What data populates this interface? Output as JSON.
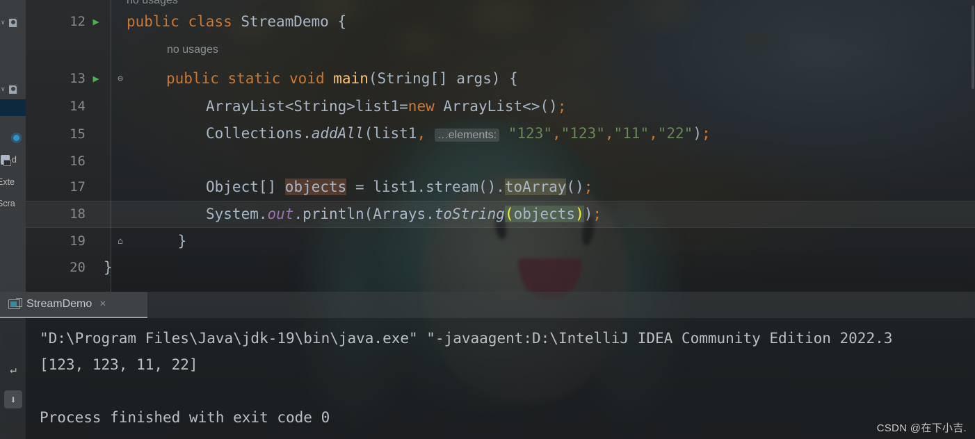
{
  "app": {
    "title": "IntelliJ IDEA Community Edition 2022.3",
    "theme_accent": "#cc7832"
  },
  "project_panel": {
    "rows": [
      {
        "chevron": "∨",
        "icon": "java-file-icon",
        "label": "",
        "selected": false
      },
      {
        "chevron": "∨",
        "icon": "java-file-icon",
        "label": "",
        "selected": false
      },
      {
        "chevron": "",
        "icon": "selected-row",
        "label": "",
        "selected": true
      },
      {
        "chevron": "",
        "icon": "circle-icon",
        "label": "",
        "selected": false
      },
      {
        "chevron": "",
        "icon": "module-icon",
        "label": "d",
        "selected": false
      },
      {
        "chevron": "",
        "icon": "",
        "label": "Exte",
        "selected": false
      },
      {
        "chevron": "",
        "icon": "",
        "label": "Scra",
        "selected": false
      }
    ]
  },
  "editor": {
    "inlay_hint_text": "no usages",
    "lines": [
      {
        "number": "",
        "run_marker": "",
        "fold_marker": "",
        "kind": "inlay",
        "inlay": "no usages",
        "inlay_indent": 60
      },
      {
        "number": "12",
        "run_marker": "▶",
        "fold_marker": "",
        "kind": "code",
        "text": "public class StreamDemo {"
      },
      {
        "number": "",
        "run_marker": "",
        "fold_marker": "",
        "kind": "inlay",
        "inlay": "no usages",
        "inlay_indent": 58
      },
      {
        "number": "13",
        "run_marker": "▶",
        "fold_marker": "⊖",
        "kind": "code",
        "text": "    public static void main(String[] args) {"
      },
      {
        "number": "14",
        "run_marker": "",
        "fold_marker": "",
        "kind": "code",
        "text": "        ArrayList<String>list1=new ArrayList<>();"
      },
      {
        "number": "15",
        "run_marker": "",
        "fold_marker": "",
        "kind": "code",
        "text": "        Collections.addAll(list1, …elements: \"123\",\"123\",\"11\",\"22\");"
      },
      {
        "number": "16",
        "run_marker": "",
        "fold_marker": "",
        "kind": "code",
        "text": ""
      },
      {
        "number": "17",
        "run_marker": "",
        "fold_marker": "",
        "kind": "code",
        "text": "        Object[] objects = list1.stream().toArray();"
      },
      {
        "number": "18",
        "run_marker": "",
        "fold_marker": "",
        "kind": "code",
        "current": true,
        "text": "        System.out.println(Arrays.toString(objects));"
      },
      {
        "number": "19",
        "run_marker": "",
        "fold_marker": "⌂",
        "kind": "code",
        "text": "    }"
      },
      {
        "number": "20",
        "run_marker": "",
        "fold_marker": "",
        "kind": "code",
        "text": "}"
      }
    ]
  },
  "run_window": {
    "tab_label": "StreamDemo",
    "tab_close": "×",
    "toolbar_buttons": [
      {
        "name": "soft-wrap-button",
        "glyph": "↵"
      },
      {
        "name": "scroll-to-end-button",
        "glyph": "⬇"
      }
    ],
    "console_lines": [
      "\"D:\\Program Files\\Java\\jdk-19\\bin\\java.exe\" \"-javaagent:D:\\IntelliJ IDEA Community Edition 2022.3",
      "[123, 123, 11, 22]",
      "",
      "Process finished with exit code 0"
    ]
  },
  "watermark": {
    "text": "CSDN @在下小吉."
  }
}
